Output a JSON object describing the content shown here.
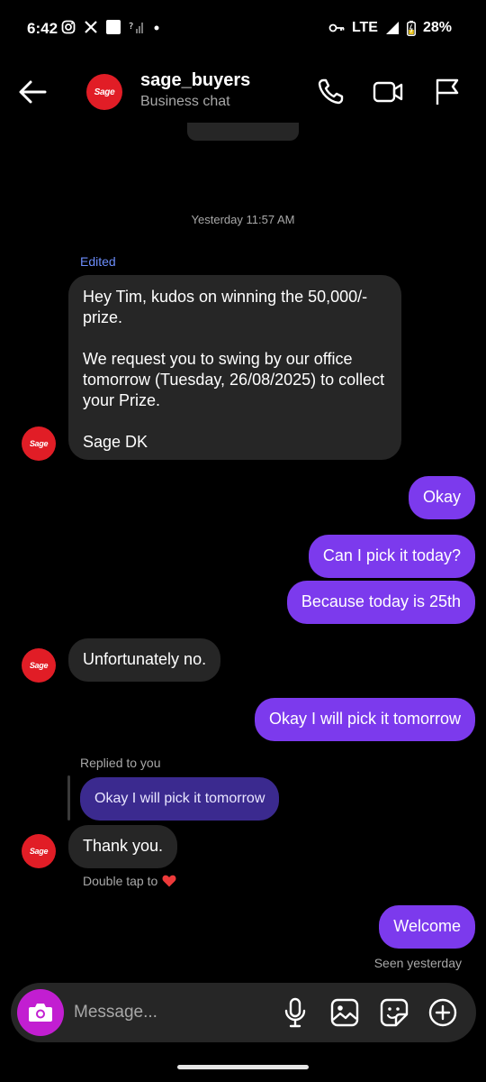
{
  "status_bar": {
    "time": "6:42",
    "network": "LTE",
    "battery": "28%",
    "icons": [
      "instagram-icon",
      "x-icon",
      "app-square-icon",
      "signal-question-icon",
      "dot-icon",
      "key-icon",
      "cell-signal-icon",
      "battery-icon"
    ]
  },
  "header": {
    "title": "sage_buyers",
    "subtitle": "Business chat",
    "avatar_text": "Sage",
    "icons": [
      "back-arrow-icon",
      "phone-icon",
      "video-call-icon",
      "flag-icon"
    ]
  },
  "chat": {
    "timestamp": "Yesterday 11:57 AM",
    "edited_label": "Edited",
    "messages": [
      {
        "from": "them",
        "text": "Hey Tim, kudos on winning the 50,000/- prize.\n\nWe request you to swing by our office tomorrow (Tuesday, 26/08/2025) to collect your Prize.\n\nSage DK"
      },
      {
        "from": "me",
        "text": "Okay"
      },
      {
        "from": "me",
        "text": "Can I pick it today?"
      },
      {
        "from": "me",
        "text": "Because today is 25th"
      },
      {
        "from": "them",
        "text": "Unfortunately no."
      },
      {
        "from": "me",
        "text": "Okay I will pick it tomorrow"
      },
      {
        "from": "them",
        "text": "Thank you."
      },
      {
        "from": "me",
        "text": "Welcome"
      }
    ],
    "reply_label": "Replied to you",
    "reply_quote": "Okay I will pick it tomorrow",
    "double_tap_label": "Double tap to",
    "seen_label": "Seen yesterday"
  },
  "composer": {
    "placeholder": "Message...",
    "icons": [
      "camera-icon",
      "microphone-icon",
      "gallery-icon",
      "sticker-icon",
      "plus-icon"
    ]
  },
  "colors": {
    "outgoing_bubble": "#7c3aed",
    "incoming_bubble": "#262626",
    "reply_bubble": "#3b2a8f",
    "camera_button": "#c21ed1",
    "edited_label": "#6c8dfb",
    "avatar_bg": "#e11d26"
  }
}
